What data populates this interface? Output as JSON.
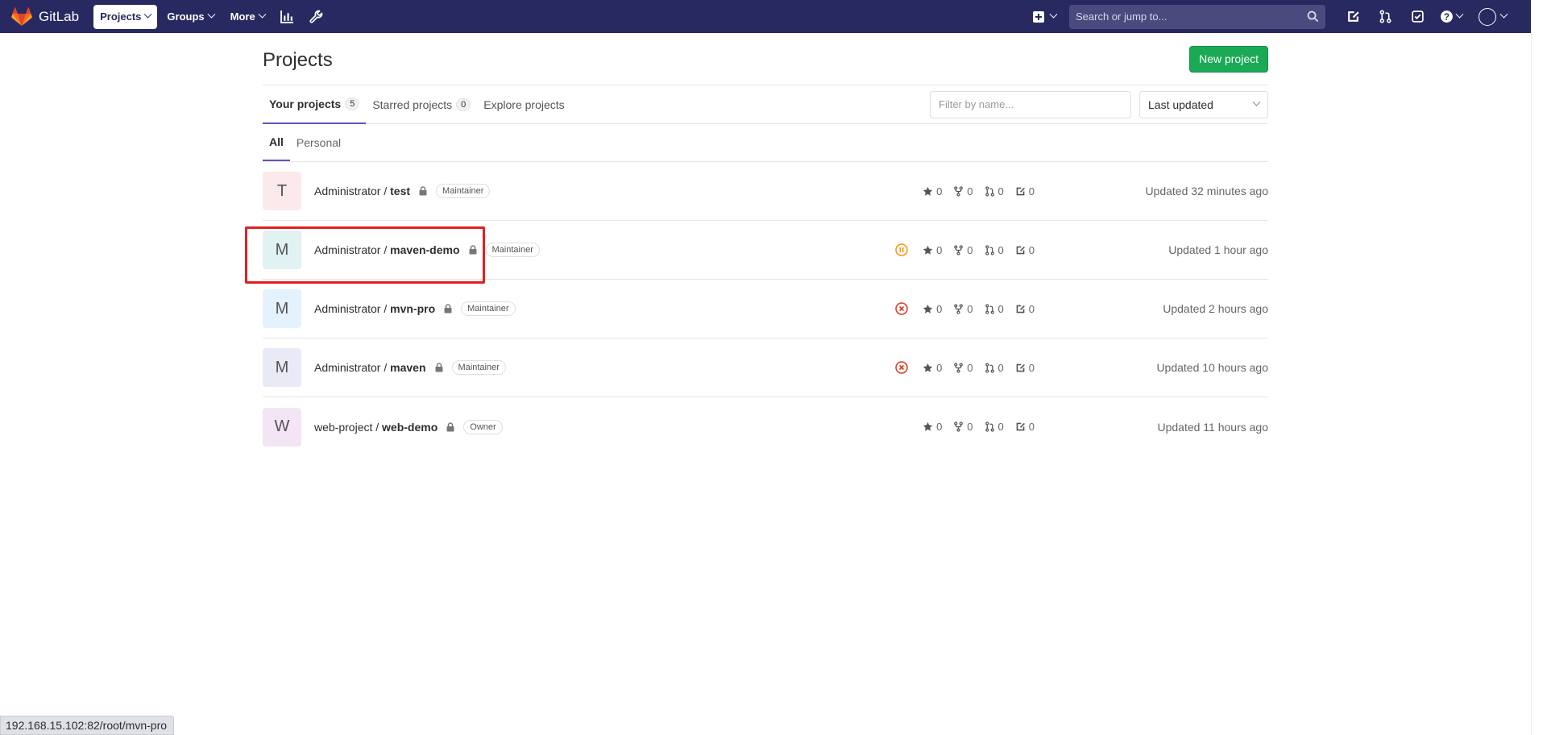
{
  "navbar": {
    "brand": "GitLab",
    "menu": [
      {
        "label": "Projects",
        "active": true
      },
      {
        "label": "Groups",
        "active": false
      },
      {
        "label": "More",
        "active": false
      }
    ],
    "search_placeholder": "Search or jump to...",
    "bg_color": "#292961"
  },
  "page": {
    "title": "Projects",
    "new_button": "New project",
    "tabs": [
      {
        "label": "Your projects",
        "count": "5"
      },
      {
        "label": "Starred projects",
        "count": "0"
      },
      {
        "label": "Explore projects"
      }
    ],
    "filter_placeholder": "Filter by name...",
    "sort_value": "Last updated",
    "subtabs": [
      "All",
      "Personal"
    ]
  },
  "projects": [
    {
      "letter": "T",
      "namespace": "Administrator / ",
      "name": "test",
      "role": "Maintainer",
      "stars": "0",
      "forks": "0",
      "mrs": "0",
      "issues": "0",
      "updated": "Updated 32 minutes ago",
      "avatar_color": "#fbe9eb",
      "pipeline": "none"
    },
    {
      "letter": "M",
      "namespace": "Administrator / ",
      "name": "maven-demo",
      "role": "Maintainer",
      "stars": "0",
      "forks": "0",
      "mrs": "0",
      "issues": "0",
      "updated": "Updated 1 hour ago",
      "avatar_color": "#e0f2f1",
      "pipeline": "paused"
    },
    {
      "letter": "M",
      "namespace": "Administrator / ",
      "name": "mvn-pro",
      "role": "Maintainer",
      "stars": "0",
      "forks": "0",
      "mrs": "0",
      "issues": "0",
      "updated": "Updated 2 hours ago",
      "avatar_color": "#e3f2fd",
      "pipeline": "failed"
    },
    {
      "letter": "M",
      "namespace": "Administrator / ",
      "name": "maven",
      "role": "Maintainer",
      "stars": "0",
      "forks": "0",
      "mrs": "0",
      "issues": "0",
      "updated": "Updated 10 hours ago",
      "avatar_color": "#e8eaf6",
      "pipeline": "failed"
    },
    {
      "letter": "W",
      "namespace": "web-project / ",
      "name": "web-demo",
      "role": "Owner",
      "stars": "0",
      "forks": "0",
      "mrs": "0",
      "issues": "0",
      "updated": "Updated 11 hours ago",
      "avatar_color": "#f3e5f5",
      "pipeline": "none"
    }
  ],
  "status_url": "192.168.15.102:82/root/mvn-pro",
  "colors": {
    "accent": "#6b4fbb",
    "success": "#1aaa55",
    "failed": "#db3b21",
    "paused": "#fc9403",
    "highlight": "#e02020"
  }
}
